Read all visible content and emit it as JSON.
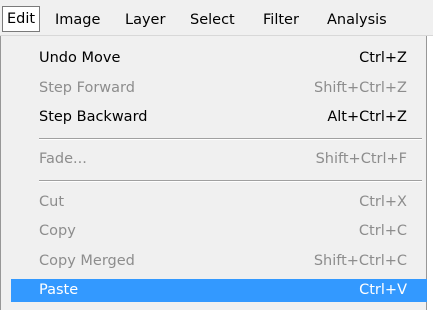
{
  "menubar": {
    "items": [
      {
        "label": "Edit",
        "active": true
      },
      {
        "label": "Image"
      },
      {
        "label": "Layer"
      },
      {
        "label": "Select"
      },
      {
        "label": "Filter"
      },
      {
        "label": "Analysis"
      }
    ]
  },
  "edit_menu": {
    "undo_move": {
      "label": "Undo Move",
      "shortcut": "Ctrl+Z",
      "enabled": true
    },
    "step_forward": {
      "label": "Step Forward",
      "shortcut": "Shift+Ctrl+Z",
      "enabled": false
    },
    "step_backward": {
      "label": "Step Backward",
      "shortcut": "Alt+Ctrl+Z",
      "enabled": true
    },
    "fade": {
      "label": "Fade...",
      "shortcut": "Shift+Ctrl+F",
      "enabled": false
    },
    "cut": {
      "label": "Cut",
      "shortcut": "Ctrl+X",
      "enabled": false
    },
    "copy": {
      "label": "Copy",
      "shortcut": "Ctrl+C",
      "enabled": false
    },
    "copy_merged": {
      "label": "Copy Merged",
      "shortcut": "Shift+Ctrl+C",
      "enabled": false
    },
    "paste": {
      "label": "Paste",
      "shortcut": "Ctrl+V",
      "enabled": true,
      "highlighted": true
    }
  },
  "colors": {
    "highlight": "#3399ff",
    "disabled_text": "#8d8d8d",
    "menu_background": "#f0f0f0"
  }
}
